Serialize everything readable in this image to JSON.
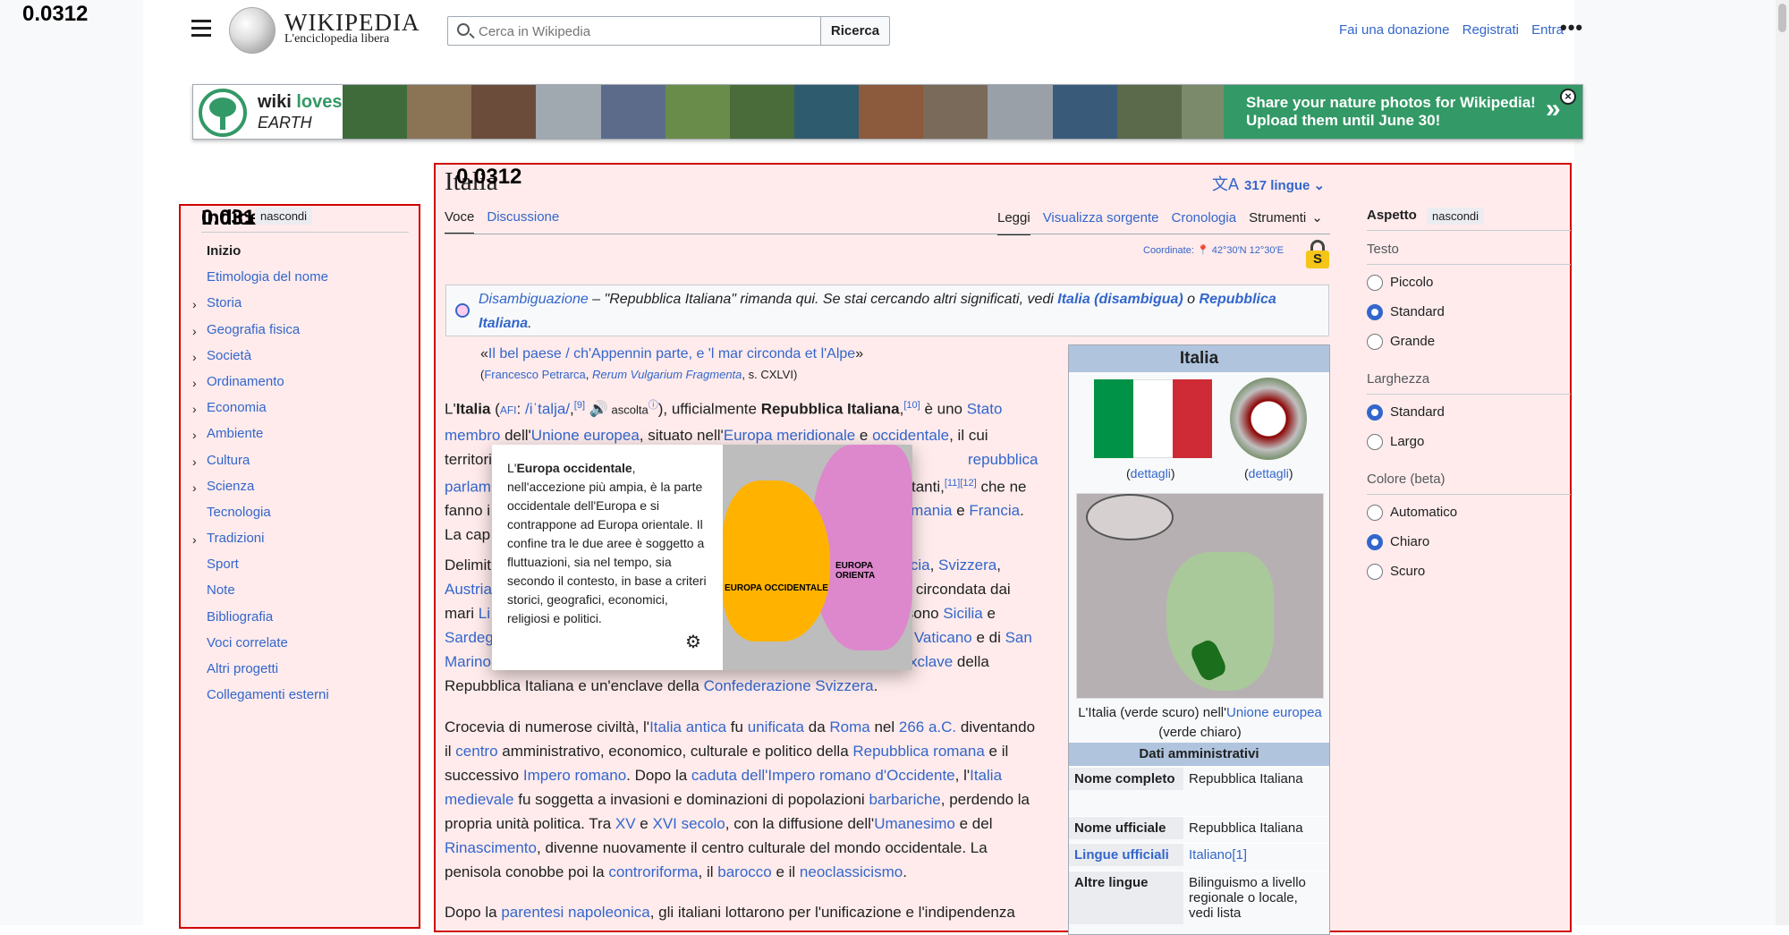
{
  "debug": {
    "top_left": "0.0312",
    "toc_overlay": "0.0312",
    "title_overlay": "0.0312"
  },
  "header": {
    "site_title": "WIKIPEDIA",
    "site_subtitle": "L'enciclopedia libera",
    "search_placeholder": "Cerca in Wikipedia",
    "search_button": "Ricerca",
    "links": [
      "Fai una donazione",
      "Registrati",
      "Entra"
    ],
    "more": "•••"
  },
  "banner": {
    "logo_word1": "wiki",
    "logo_word2": "loves",
    "logo_word3": "EARTH",
    "cta_line1": "Share your nature photos for Wikipedia!",
    "cta_line2": "Upload them until June 30!",
    "arrow": "»",
    "close": "×",
    "photo_colors": [
      "#3f6b3a",
      "#8b7355",
      "#6b4c3b",
      "#a0a8b0",
      "#5c6b8a",
      "#6a8c4a",
      "#4a6b3a",
      "#2f5b6f",
      "#8c5a3c",
      "#7a6a5a",
      "#9aa0a8",
      "#3a5a7a",
      "#5a6a4a",
      "#7a8a6a"
    ]
  },
  "toc": {
    "title": "Indice",
    "hide": "nascondi",
    "items": [
      {
        "label": "Inizio",
        "chev": false,
        "current": true
      },
      {
        "label": "Etimologia del nome",
        "chev": false
      },
      {
        "label": "Storia",
        "chev": true
      },
      {
        "label": "Geografia fisica",
        "chev": true
      },
      {
        "label": "Società",
        "chev": true
      },
      {
        "label": "Ordinamento",
        "chev": true
      },
      {
        "label": "Economia",
        "chev": true
      },
      {
        "label": "Ambiente",
        "chev": true
      },
      {
        "label": "Cultura",
        "chev": true
      },
      {
        "label": "Scienza",
        "chev": true
      },
      {
        "label": "Tecnologia",
        "chev": false
      },
      {
        "label": "Tradizioni",
        "chev": true
      },
      {
        "label": "Sport",
        "chev": false
      },
      {
        "label": "Note",
        "chev": false
      },
      {
        "label": "Bibliografia",
        "chev": false
      },
      {
        "label": "Voci correlate",
        "chev": false
      },
      {
        "label": "Altri progetti",
        "chev": false
      },
      {
        "label": "Collegamenti esterni",
        "chev": false
      }
    ]
  },
  "article": {
    "title": "Italia",
    "languages": "317 lingue",
    "tabs_left": [
      "Voce",
      "Discussione"
    ],
    "tabs_right": [
      "Leggi",
      "Visualizza sorgente",
      "Cronologia",
      "Strumenti"
    ],
    "coords_label": "Coordinate:",
    "coords_value": "42°30′N 12°30′E",
    "hatnote_part1": "Disambiguazione",
    "hatnote_part2": " – \"Repubblica Italiana\" rimanda qui. Se stai cercando altri significati, vedi ",
    "hatnote_link1": "Italia (disambigua)",
    "hatnote_part3": " o ",
    "hatnote_link2": "Repubblica Italiana",
    "hatnote_end": ".",
    "quote": "Il bel paese / ch'Appennin parte, e 'l mar circonda et l'Alpe",
    "quote_src_author": "Francesco Petrarca",
    "quote_src_work": "Rerum Vulgarium Fragmenta",
    "quote_src_ref": ", s. CXLVI)"
  },
  "infobox": {
    "title": "Italia",
    "dettagli": "dettagli",
    "map_caption_1": "L'Italia (verde scuro) nell'",
    "map_caption_link": "Unione europea",
    "map_caption_2": " (verde chiaro)",
    "section": "Dati amministrativi",
    "rows": [
      {
        "k": "Nome completo",
        "v": "Repubblica Italiana"
      },
      {
        "k": "Nome ufficiale",
        "v": "Repubblica Italiana"
      },
      {
        "k": "Lingue ufficiali",
        "v": "Italiano[1]"
      },
      {
        "k": "Altre lingue",
        "v": "Bilinguismo a livello regionale o locale, vedi lista"
      }
    ]
  },
  "popup": {
    "text_pre": "L'",
    "text_bold": "Europa occidentale",
    "text_post": ", nell'accezione più ampia, è la parte occidentale dell'Europa e si contrappone ad Europa orientale. Il confine tra le due aree è soggetto a fluttuazioni, sia nel tempo, sia secondo il contesto, in base a criteri storici, geografici, economici, religiosi e politici.",
    "label_west": "EUROPA OCCIDENTALE",
    "label_east": "EUROPA ORIENTA"
  },
  "aspetto": {
    "title": "Aspetto",
    "hide": "nascondi",
    "groups": [
      {
        "name": "Testo",
        "options": [
          "Piccolo",
          "Standard",
          "Grande"
        ],
        "selected": 1
      },
      {
        "name": "Larghezza",
        "options": [
          "Standard",
          "Largo"
        ],
        "selected": 0
      },
      {
        "name": "Colore (beta)",
        "options": [
          "Automatico",
          "Chiaro",
          "Scuro"
        ],
        "selected": 1
      }
    ]
  }
}
